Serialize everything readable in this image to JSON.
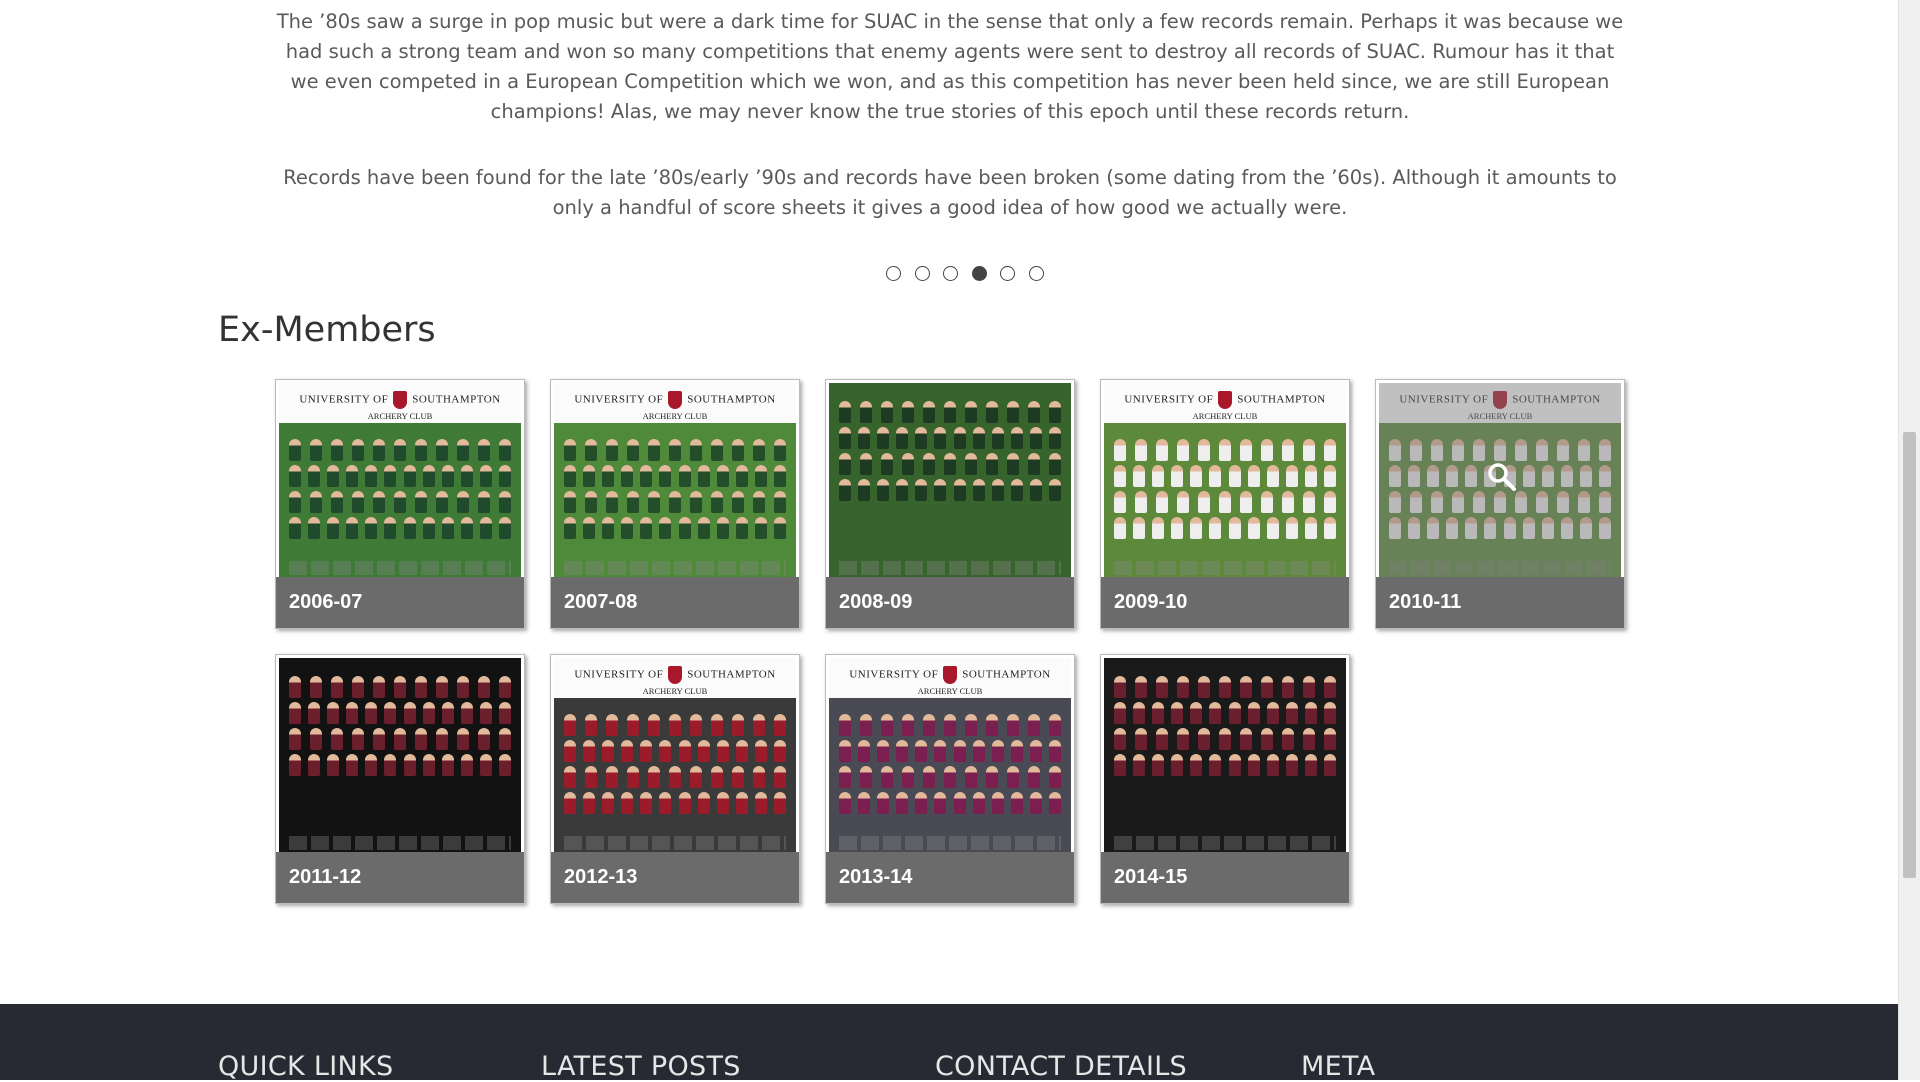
{
  "history": {
    "paragraph1": "The ’80s saw a surge in pop music but were a dark time for SUAC in the sense that only a few records remain. Perhaps it was because we had such a strong team and won so many competitions that enemy agents were sent to destroy all records of SUAC. Rumour has it that we even competed in a European Competition which we won, and as this competition has never been held since, we are still European champions! Alas, we may never know the true stories of this epoch until these records return.",
    "paragraph2": "Records have been found for the late ’80s/early ’90s and records have been broken (some dating from the ’60s). Although it amounts to only a handful of score sheets it gives a good idea of how good we actually were."
  },
  "slider": {
    "total": 6,
    "active_index": 3
  },
  "section_title": "Ex-Members",
  "photo_header": {
    "university": "UNIVERSITY OF",
    "city": "SOUTHAMPTON",
    "club": "ARCHERY CLUB"
  },
  "gallery": [
    {
      "label": "2006-07",
      "shirt": "#1f4a2c",
      "bg": "#3f7a36",
      "header": true
    },
    {
      "label": "2007-08",
      "shirt": "#244d2a",
      "bg": "#4f8a3a",
      "header": true
    },
    {
      "label": "2008-09",
      "shirt": "#1d3a22",
      "bg": "#37642c",
      "header": false
    },
    {
      "label": "2009-10",
      "shirt": "#eeeeee",
      "bg": "#5d8a3a",
      "header": true
    },
    {
      "label": "2010-11",
      "shirt": "#eeeeee",
      "bg": "#5a8a3c",
      "header": true,
      "hover": true
    },
    {
      "label": "2011-12",
      "shirt": "#6b1f2c",
      "bg": "#121212",
      "header": false
    },
    {
      "label": "2012-13",
      "shirt": "#9a1b2a",
      "bg": "#3a3a3a",
      "header": true
    },
    {
      "label": "2013-14",
      "shirt": "#7a1f4f",
      "bg": "#4a4a55",
      "header": true
    },
    {
      "label": "2014-15",
      "shirt": "#6a1e2e",
      "bg": "#1a1a1a",
      "header": false
    }
  ],
  "icons": {
    "hover_icon": "search-icon"
  },
  "footer": {
    "quick_links": "QUICK LINKS",
    "latest_posts": "LATEST POSTS",
    "contact_details": "CONTACT DETAILS",
    "meta": "META"
  },
  "colors": {
    "footer_bg": "#272a33",
    "caption_bg": "#6b6b6b",
    "dot_active": "#444444"
  }
}
